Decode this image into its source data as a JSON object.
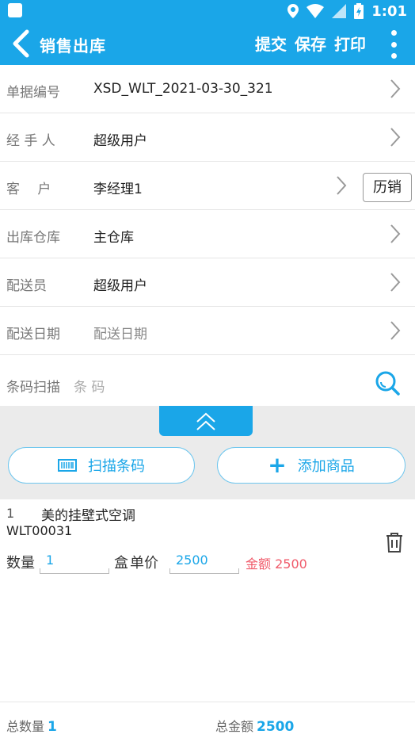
{
  "status_bar": {
    "time": "1:01"
  },
  "app_bar": {
    "title": "销售出库",
    "submit_label": "提交",
    "save_label": "保存",
    "print_label": "打印"
  },
  "form": {
    "doc_no": {
      "label": "单据编号",
      "value": "XSD_WLT_2021-03-30_321"
    },
    "handler": {
      "label": "经 手 人",
      "value": "超级用户"
    },
    "customer": {
      "label": "客　 户",
      "value": "李经理1",
      "history_label": "历销"
    },
    "warehouse": {
      "label": "出库仓库",
      "value": "主仓库"
    },
    "courier": {
      "label": "配送员",
      "value": "超级用户"
    },
    "delivery_date": {
      "label": "配送日期",
      "placeholder": "配送日期"
    },
    "barcode": {
      "label": "条码扫描",
      "placeholder": "条 码"
    }
  },
  "actions": {
    "scan_label": "扫描条码",
    "add_label": "添加商品"
  },
  "items": [
    {
      "index": "1",
      "name": "美的挂壁式空调",
      "code": "WLT00031",
      "qty_label": "数量",
      "qty": "1",
      "unit": "盒",
      "price_label": "单价",
      "price": "2500",
      "amount": "金额 2500"
    }
  ],
  "footer": {
    "total_qty_label": "总数量",
    "total_qty": "1",
    "total_amount_label": "总金额",
    "total_amount": "2500"
  },
  "colors": {
    "primary": "#1aa6e8",
    "amount": "#f05a6a"
  }
}
